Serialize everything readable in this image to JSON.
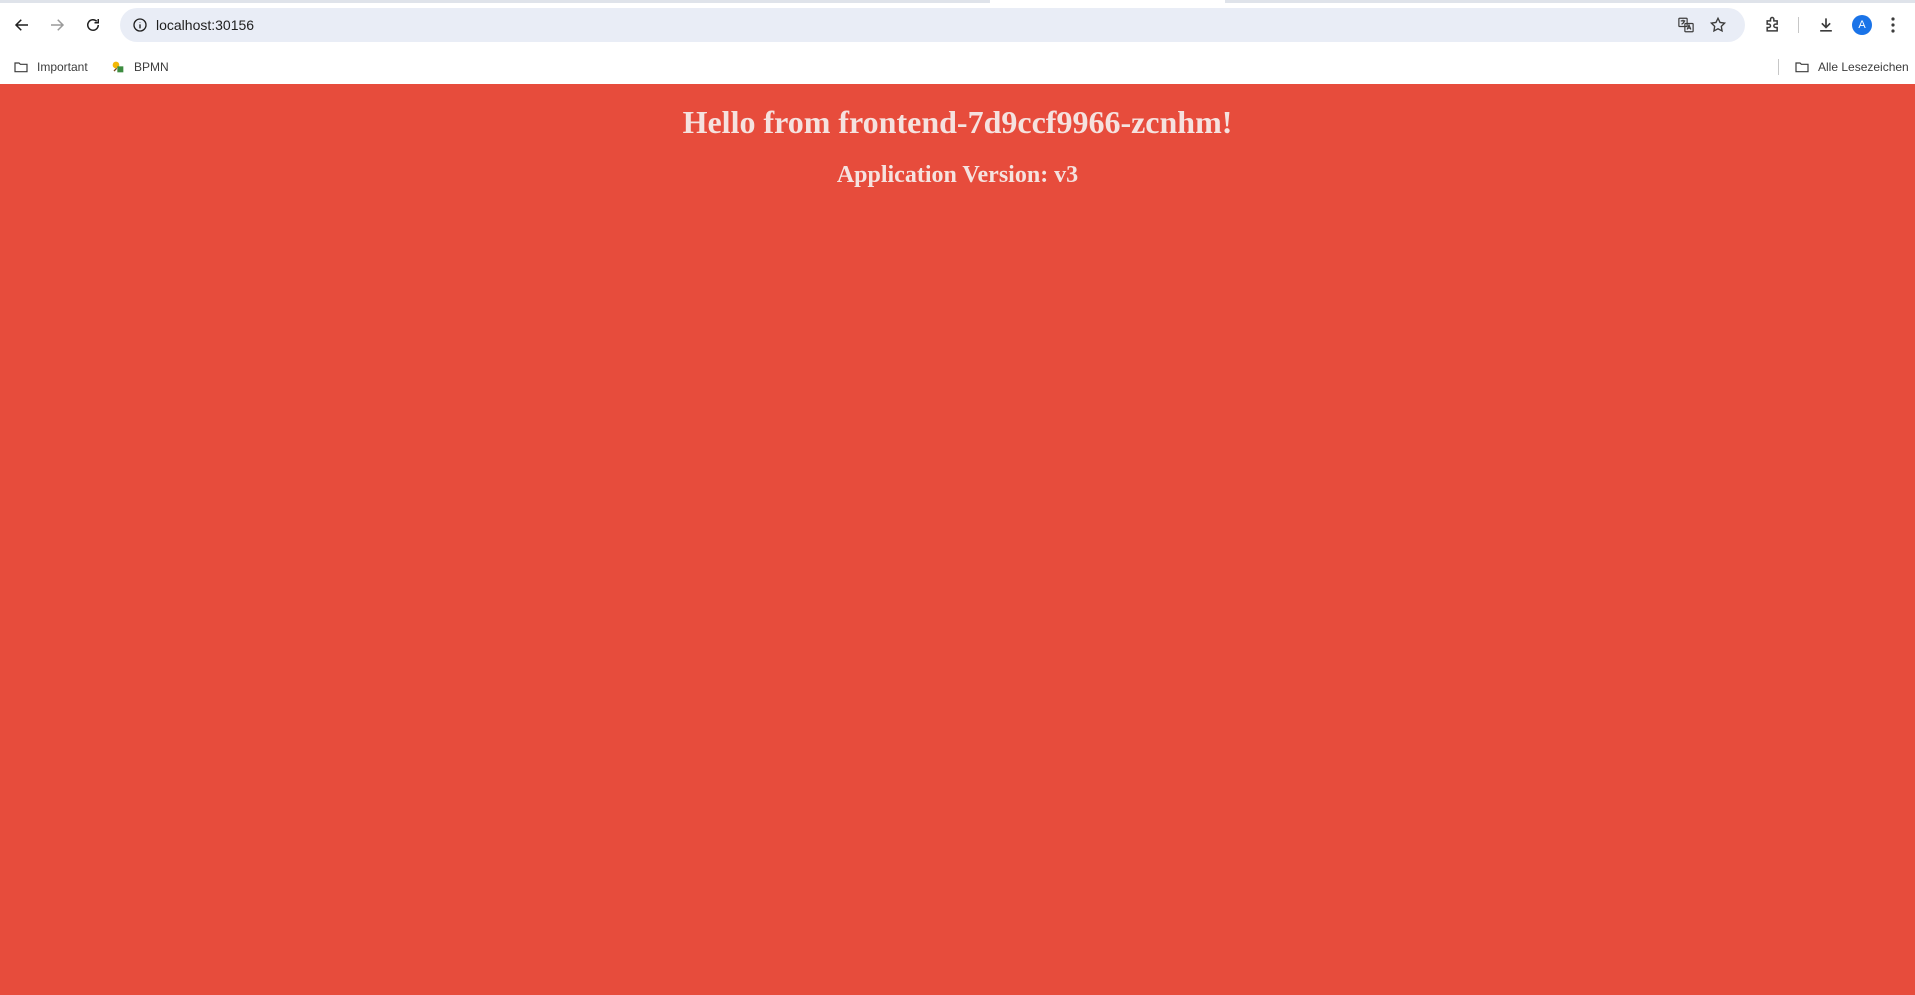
{
  "browser": {
    "url": "localhost:30156",
    "profile_initial": "A",
    "icons": {
      "back": "arrow-left-icon",
      "forward": "arrow-right-icon",
      "reload": "reload-icon",
      "site_info": "info-icon",
      "translate": "translate-icon",
      "bookmark": "star-icon",
      "extensions": "puzzle-icon",
      "downloads": "download-icon",
      "menu": "kebab-menu-icon"
    }
  },
  "bookmarks_bar": {
    "items": [
      {
        "label": "Important",
        "icon": "folder-icon"
      },
      {
        "label": "BPMN",
        "icon": "bpmn-favicon"
      }
    ],
    "all_bookmarks": {
      "label": "Alle Lesezeichen",
      "icon": "folder-icon"
    }
  },
  "page": {
    "background_color": "#e74c3c",
    "heading": "Hello from frontend-7d9ccf9966-zcnhm!",
    "version_text": "Application Version: v3"
  }
}
